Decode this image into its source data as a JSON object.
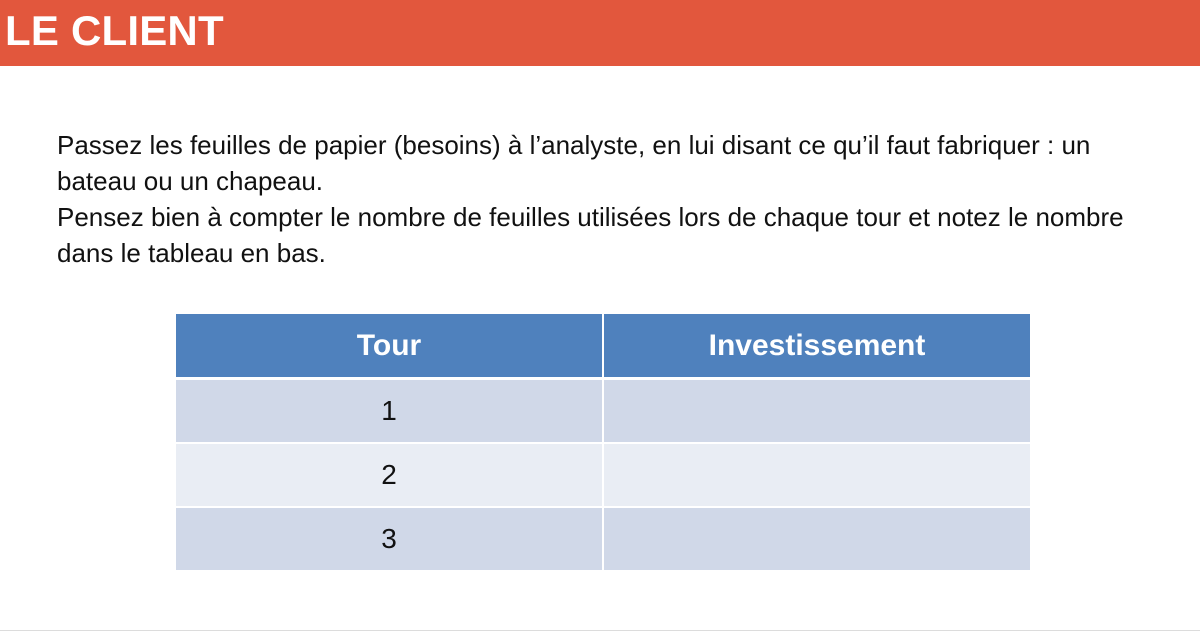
{
  "slide": {
    "title": "LE CLIENT",
    "paragraphs": [
      "Passez les feuilles de papier (besoins) à l’analyste, en lui disant ce qu’il faut fabriquer : un bateau ou un chapeau.",
      "Pensez bien à compter le nombre de feuilles utilisées lors de chaque tour et notez le nombre dans le tableau en bas."
    ]
  },
  "table": {
    "headers": [
      "Tour",
      "Investissement"
    ],
    "rows": [
      [
        "1",
        ""
      ],
      [
        "2",
        ""
      ],
      [
        "3",
        ""
      ]
    ]
  },
  "colors": {
    "title_bar": "#e2573d",
    "header_bg": "#4f81bd",
    "row_odd": "#d0d8e8",
    "row_even": "#e9edf4"
  }
}
